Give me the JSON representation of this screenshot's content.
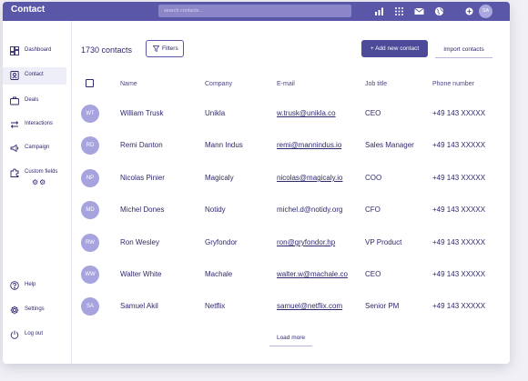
{
  "app": {
    "title": "Contact"
  },
  "search": {
    "placeholder": "search contacts..."
  },
  "topbar": {
    "icons": [
      "bar-chart-icon",
      "grid-icon",
      "mail-icon",
      "globe-icon",
      "add-circle-icon"
    ],
    "avatar_initials": "SA"
  },
  "sidebar": {
    "items": [
      {
        "label": "Dashboard",
        "icon": "dashboard-icon",
        "active": false
      },
      {
        "label": "Contact",
        "icon": "contact-icon",
        "active": true
      },
      {
        "label": "Deals",
        "icon": "briefcase-icon",
        "active": false
      },
      {
        "label": "Interactions",
        "icon": "arrows-icon",
        "active": false
      },
      {
        "label": "Campaign",
        "icon": "megaphone-icon",
        "active": false
      },
      {
        "label": "Custom fields",
        "icon": "puzzle-icon",
        "active": false,
        "extra": "⚙⚙"
      }
    ],
    "bottom_items": [
      {
        "label": "Help",
        "icon": "help-icon"
      },
      {
        "label": "Settings",
        "icon": "gear-icon"
      },
      {
        "label": "Log out",
        "icon": "power-icon"
      }
    ]
  },
  "main": {
    "count_label": "1730 contacts",
    "filters_label": "Filters",
    "add_label": "+ Add new contact",
    "import_label": "Import contacts",
    "load_more_label": "Load more",
    "columns": [
      "Name",
      "Company",
      "E-mail",
      "Job title",
      "Phone number"
    ],
    "rows": [
      {
        "initials": "WT",
        "name": "William Trusk",
        "company": "Unikla",
        "email": "w.trusk@unikla.co",
        "job": "CEO",
        "phone": "+49 143 XXXXX"
      },
      {
        "initials": "RD",
        "name": "Remi Danton",
        "company": "Mann Indus",
        "email": "remi@mannindus.io",
        "job": "Sales Manager",
        "phone": "+49 143 XXXXX"
      },
      {
        "initials": "NP",
        "name": "Nicolas Pinier",
        "company": "Magicaly",
        "email": "nicolas@magicaly.io",
        "job": "COO",
        "phone": "+49 143 XXXXX"
      },
      {
        "initials": "MD",
        "name": "Michel Dones",
        "company": "Notidy",
        "email": "michel.d@notidy.org",
        "job": "CFO",
        "phone": "+49 143 XXXXX"
      },
      {
        "initials": "RW",
        "name": "Ron Wesley",
        "company": "Gryfondor",
        "email": "ron@gryfondor.hp",
        "job": "VP Product",
        "phone": "+49 143 XXXXX"
      },
      {
        "initials": "WW",
        "name": "Walter White",
        "company": "Machale",
        "email": "walter.w@machale.co",
        "job": "CEO",
        "phone": "+49 143 XXXXX"
      },
      {
        "initials": "SA",
        "name": "Samuel Akil",
        "company": "Netflix",
        "email": "samuel@netflix.com",
        "job": "Senior PM",
        "phone": "+49 143 XXXXX"
      }
    ]
  },
  "colors": {
    "brand": "#5a57a8",
    "text": "#2e2a6e",
    "avatar": "#a6a3de"
  }
}
